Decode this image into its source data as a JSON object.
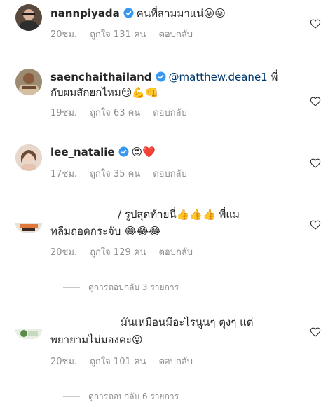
{
  "comments": [
    {
      "username": "nannpiyada",
      "text": "คนที่สามมาแน่😜😜",
      "time": "20ชม.",
      "likes": "ถูกใจ 131 คน",
      "reply": "ตอบกลับ"
    },
    {
      "username": "saenchaithailand",
      "mention": "@matthew.deane1",
      "text_line1_tail": " พี่",
      "text_line2": "กับผมสักยกไหม😏💪👊",
      "time": "19ชม.",
      "likes": "ถูกใจ 63 คน",
      "reply": "ตอบกลับ"
    },
    {
      "username": "lee_natalie",
      "text": "😍❤️",
      "time": "17ชม.",
      "likes": "ถูกใจ 35 คน",
      "reply": "ตอบกลับ"
    },
    {
      "text_line1": "/ รูปสุดท้ายนี่👍👍👍 พี่แม",
      "text_line2": "ทลืมถอดกระจับ 😂😂😂",
      "time": "20ชม.",
      "likes": "ถูกใจ 129 คน",
      "reply": "ตอบกลับ",
      "view_replies": "ดูการตอบกลับ 3 รายการ"
    },
    {
      "text_line1": "มันเหมือนมีอะไรนูนๆ ตุงๆ แต่",
      "text_line2": "พยายามไม่มองคะ😝",
      "time": "20ชม.",
      "likes": "ถูกใจ 101 คน",
      "reply": "ตอบกลับ",
      "view_replies": "ดูการตอบกลับ 6 รายการ"
    }
  ],
  "icons": {
    "verified": "verified-badge-icon",
    "like": "heart-outline-icon"
  },
  "colors": {
    "verified": "#3897f0",
    "mention": "#00376b",
    "meta": "#8e8e8e"
  }
}
